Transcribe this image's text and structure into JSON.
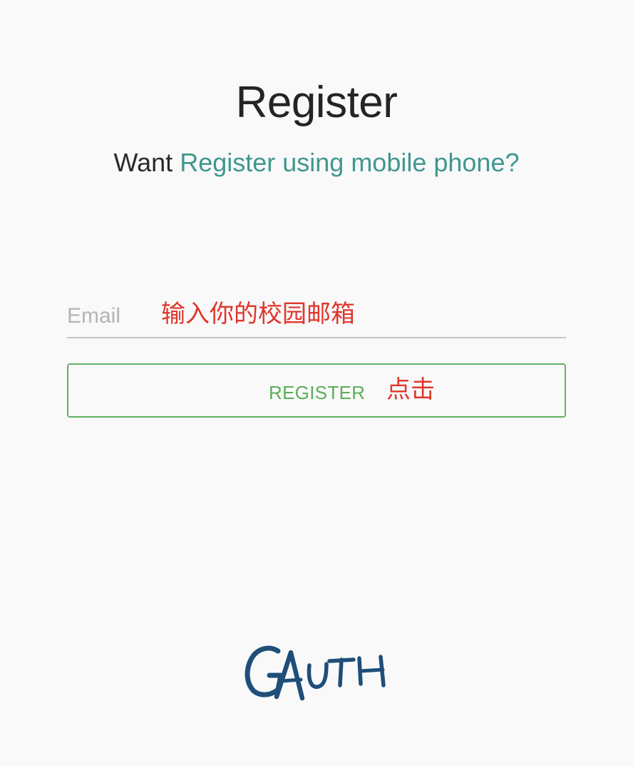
{
  "header": {
    "title": "Register",
    "subtitle_prefix": "Want ",
    "subtitle_link": "Register using mobile phone?"
  },
  "form": {
    "email": {
      "placeholder": "Email",
      "value": "",
      "annotation": "输入你的校园邮箱"
    },
    "register_button": {
      "label": "REGISTER",
      "annotation": "点击"
    }
  },
  "logo": {
    "text": "GAUTH",
    "color": "#1f4e79"
  },
  "colors": {
    "background": "#f9f9fa",
    "link": "#3f978d",
    "button": "#5cae58",
    "annotation": "#e0362a"
  }
}
